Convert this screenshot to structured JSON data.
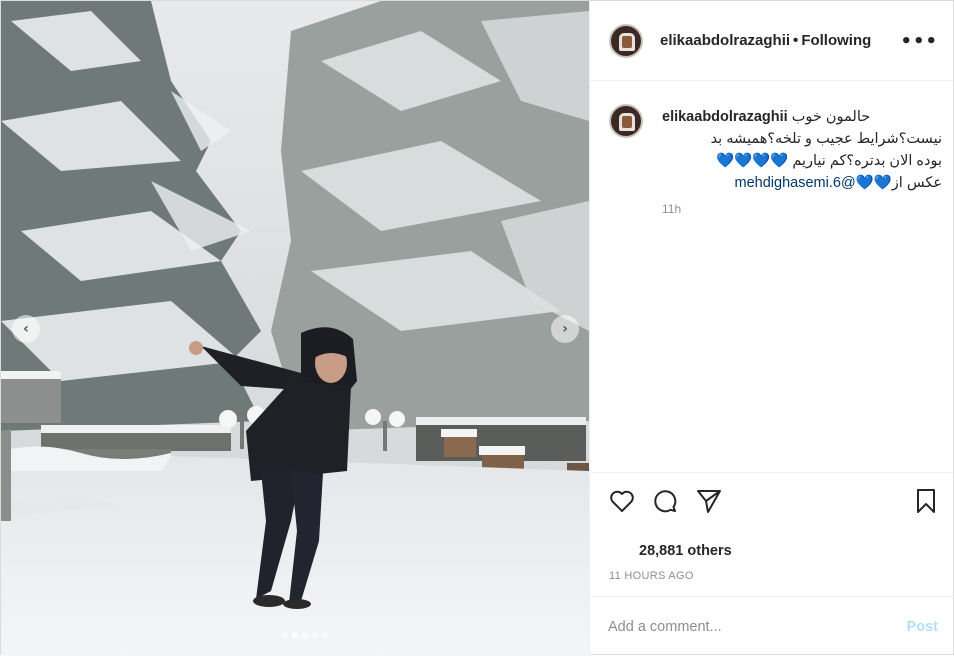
{
  "post": {
    "username": "elikaabdolrazaghii",
    "separator": "•",
    "follow_status": "Following",
    "more_icon": "more-options-icon",
    "caption_username": "elikaabdolrazaghii",
    "caption_line1": "حالمون خوب",
    "caption_line2": "نیست؟شرایط عجیب و تلخه؟همیشه بد",
    "caption_line3": "بوده الان بدتره؟کم نیاریم",
    "caption_hearts_a": "💙💙💙💙",
    "caption_line4": "عکس از",
    "caption_hearts_b": "💙💙",
    "caption_mention": "@mehdighasemi.6",
    "caption_time": "11h",
    "likes": "28,881 others",
    "time_ago": "11 HOURS AGO",
    "comment_placeholder": "Add a comment...",
    "post_label": "Post",
    "carousel": {
      "count": 5,
      "active_index": 1
    },
    "colors": {
      "heart": "#1ec0e8",
      "mention": "#00376b",
      "post_button": "#b2dffc",
      "muted": "#8e8e8e"
    }
  }
}
